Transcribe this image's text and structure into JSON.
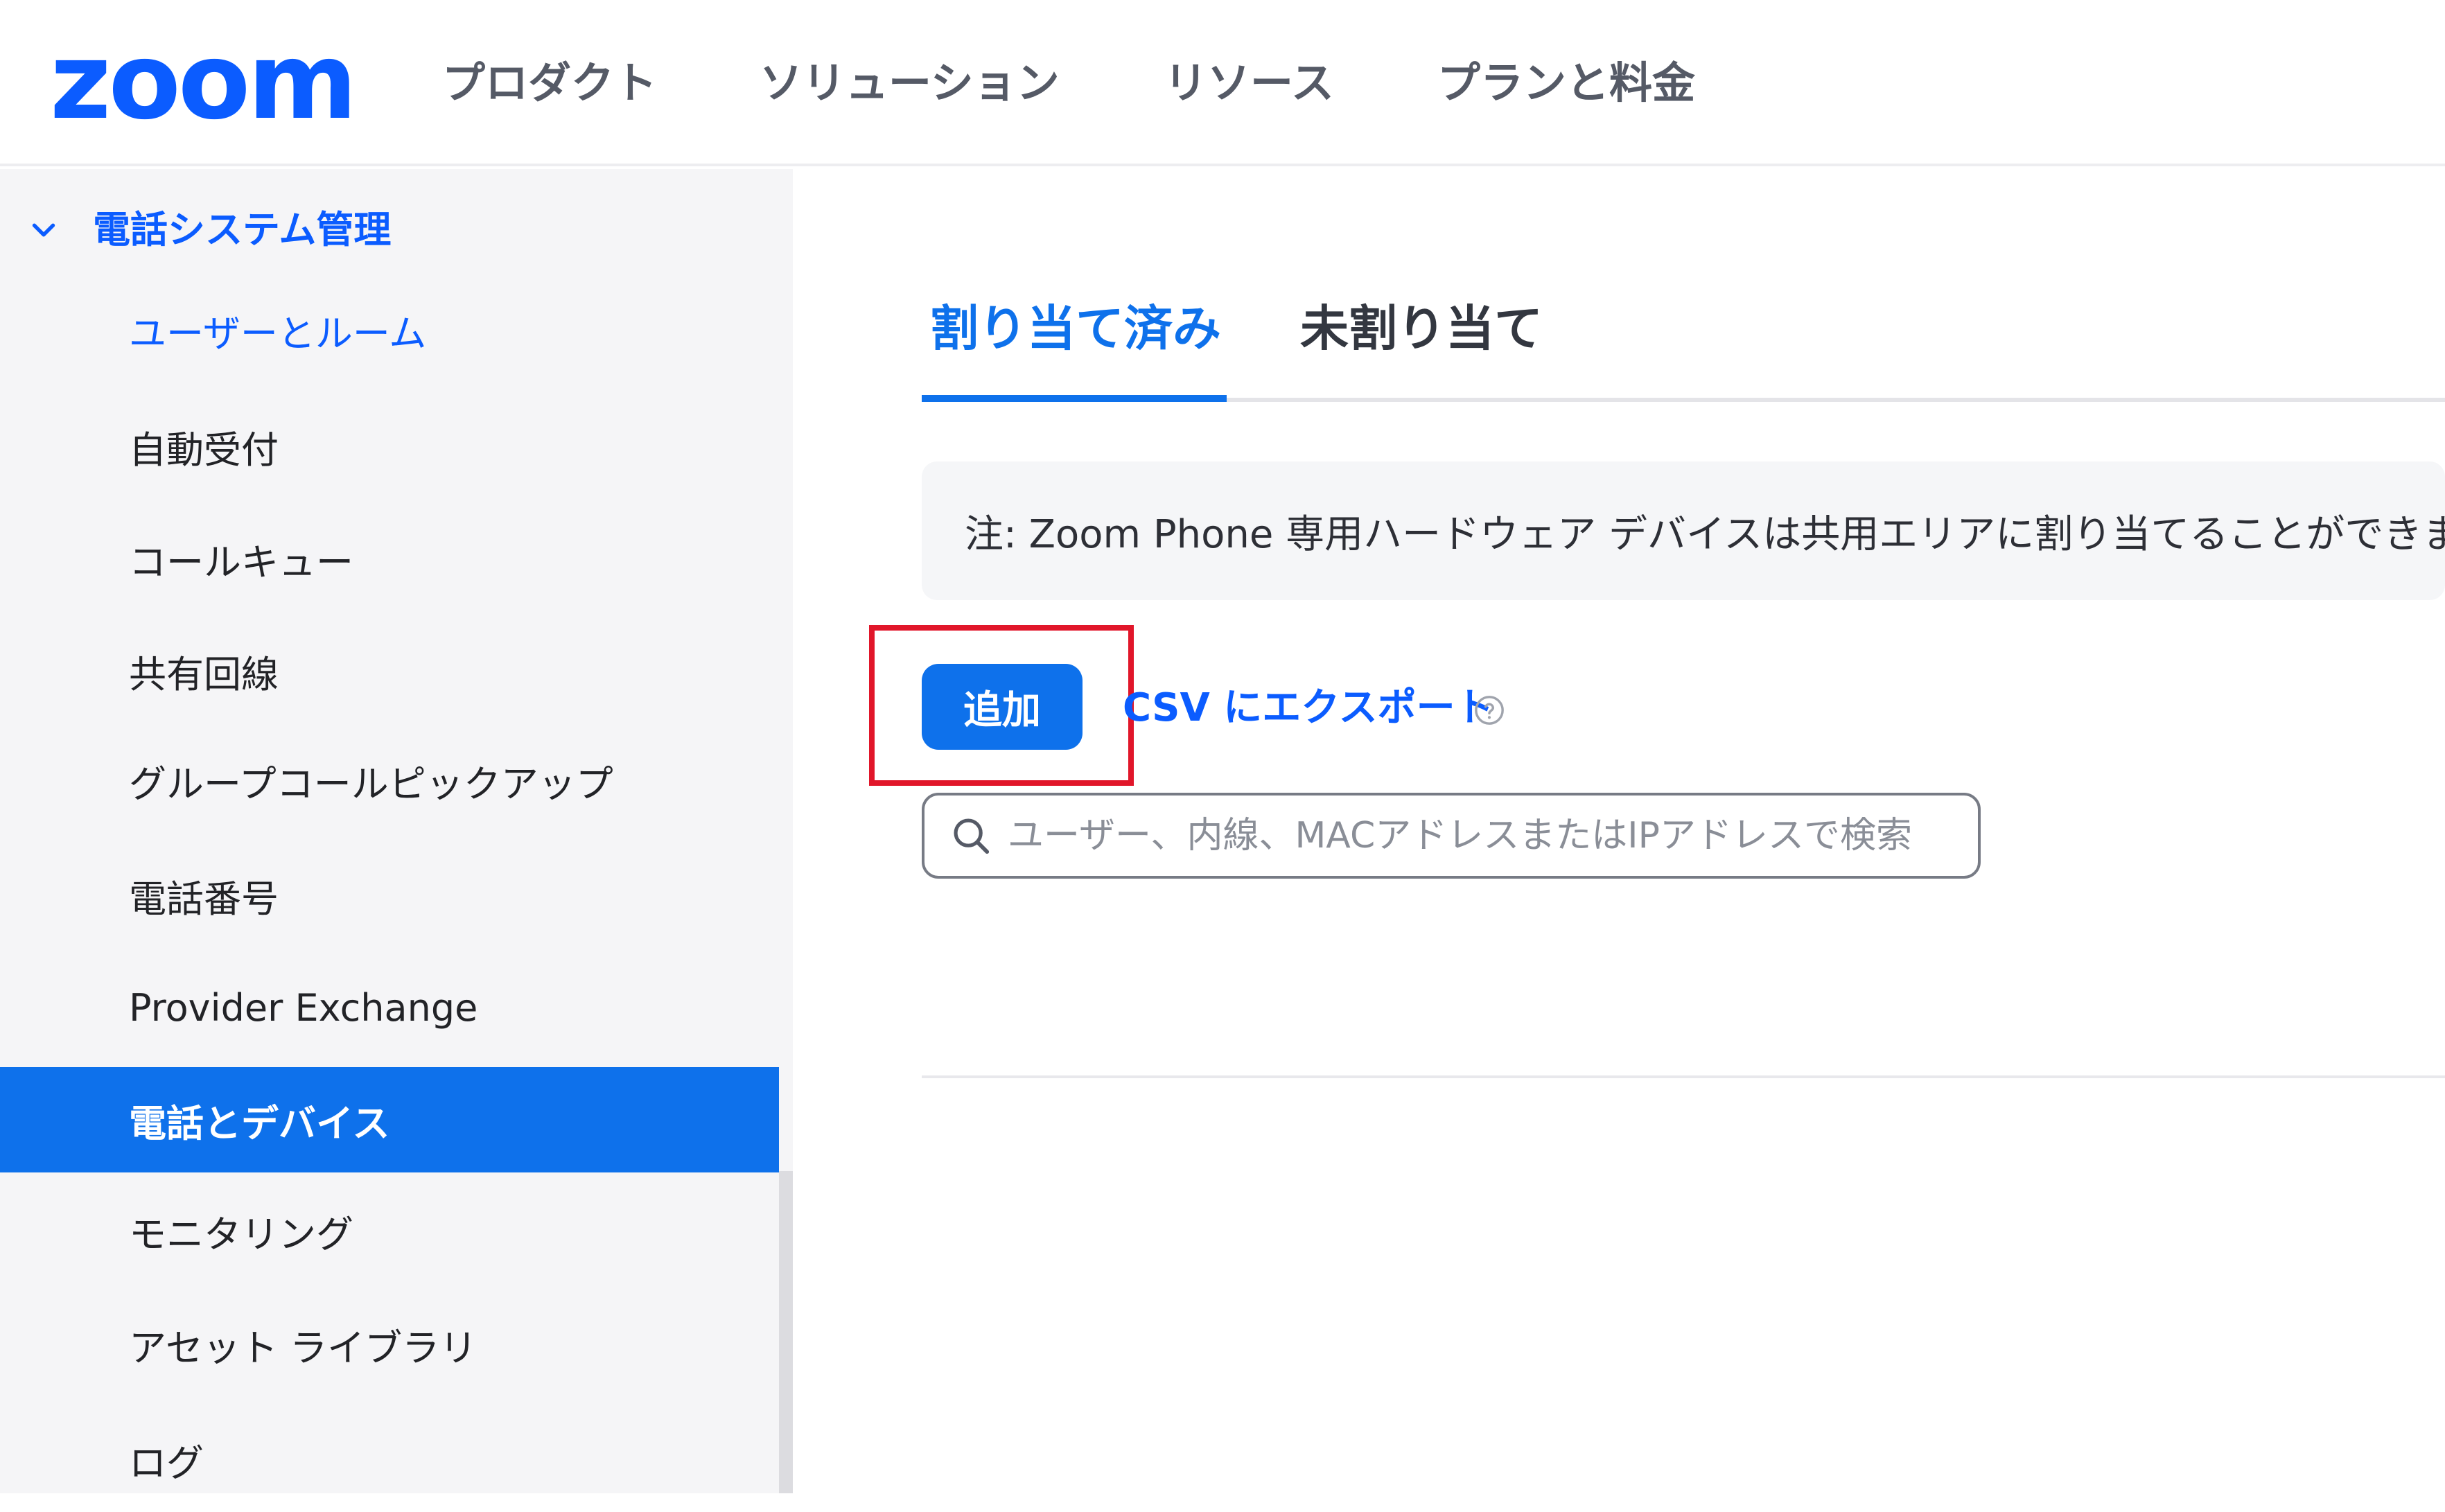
{
  "header": {
    "logo_text": "zoom",
    "nav": [
      "プロダクト",
      "ソリューション",
      "リソース",
      "プランと料金"
    ]
  },
  "sidebar": {
    "section_title": "電話システム管理",
    "items": [
      {
        "label": "ユーザーとルーム"
      },
      {
        "label": "自動受付"
      },
      {
        "label": "コールキュー"
      },
      {
        "label": "共有回線"
      },
      {
        "label": "グループコールピックアップ"
      },
      {
        "label": "電話番号"
      },
      {
        "label": "Provider Exchange"
      },
      {
        "label": "電話とデバイス"
      },
      {
        "label": "モニタリング"
      },
      {
        "label": "アセット ライブラリ"
      },
      {
        "label": "ログ"
      }
    ]
  },
  "main": {
    "tabs": [
      {
        "label": "割り当て済み",
        "active": true
      },
      {
        "label": "未割り当て",
        "active": false
      }
    ],
    "note": "注: Zoom Phone 専用ハードウェア デバイスは共用エリアに割り当てることができます。",
    "add_button": "追加",
    "export_link": "CSV にエクスポート",
    "search": {
      "placeholder": "ユーザー、内線、MACアドレスまたはIPアドレスで検索",
      "value": ""
    }
  },
  "colors": {
    "brand": "#0b5cff",
    "accent": "#0e71eb",
    "highlight": "#e1162a"
  },
  "icons": {
    "section_toggle": "chevron-down-icon",
    "help": "help-circle-icon",
    "search": "search-icon"
  }
}
